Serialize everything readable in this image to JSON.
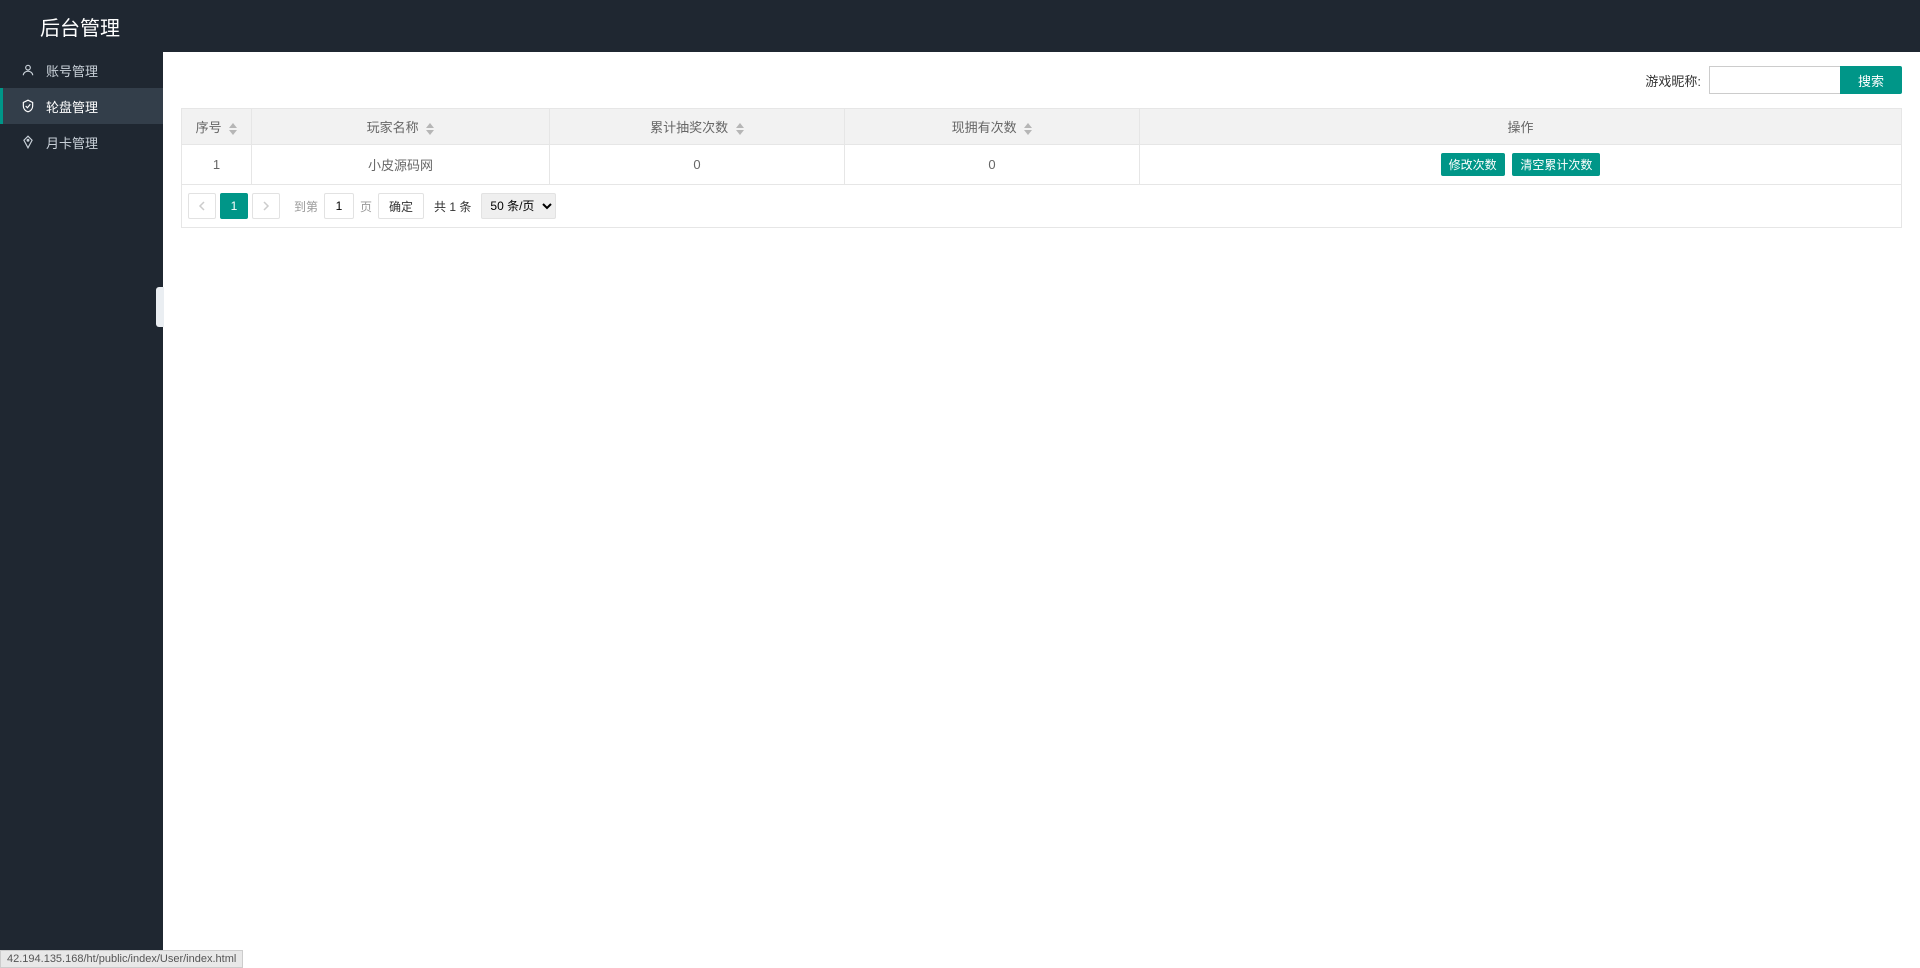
{
  "header": {
    "title": "后台管理"
  },
  "sidebar": {
    "items": [
      {
        "label": "账号管理",
        "icon": "user"
      },
      {
        "label": "轮盘管理",
        "icon": "shield"
      },
      {
        "label": "月卡管理",
        "icon": "diamond"
      }
    ]
  },
  "search": {
    "label": "游戏昵称:",
    "value": "",
    "button": "搜索"
  },
  "table": {
    "columns": [
      "序号",
      "玩家名称",
      "累计抽奖次数",
      "现拥有次数",
      "操作"
    ],
    "rows": [
      {
        "index": "1",
        "name": "小皮源码网",
        "total": "0",
        "owned": "0"
      }
    ],
    "actions": {
      "edit": "修改次数",
      "clear": "清空累计次数"
    }
  },
  "pagination": {
    "current": "1",
    "goto_label": "到第",
    "goto_value": "1",
    "goto_suffix": "页",
    "confirm": "确定",
    "total": "共 1 条",
    "size": "50 条/页"
  },
  "status": "42.194.135.168/ht/public/index/User/index.html"
}
